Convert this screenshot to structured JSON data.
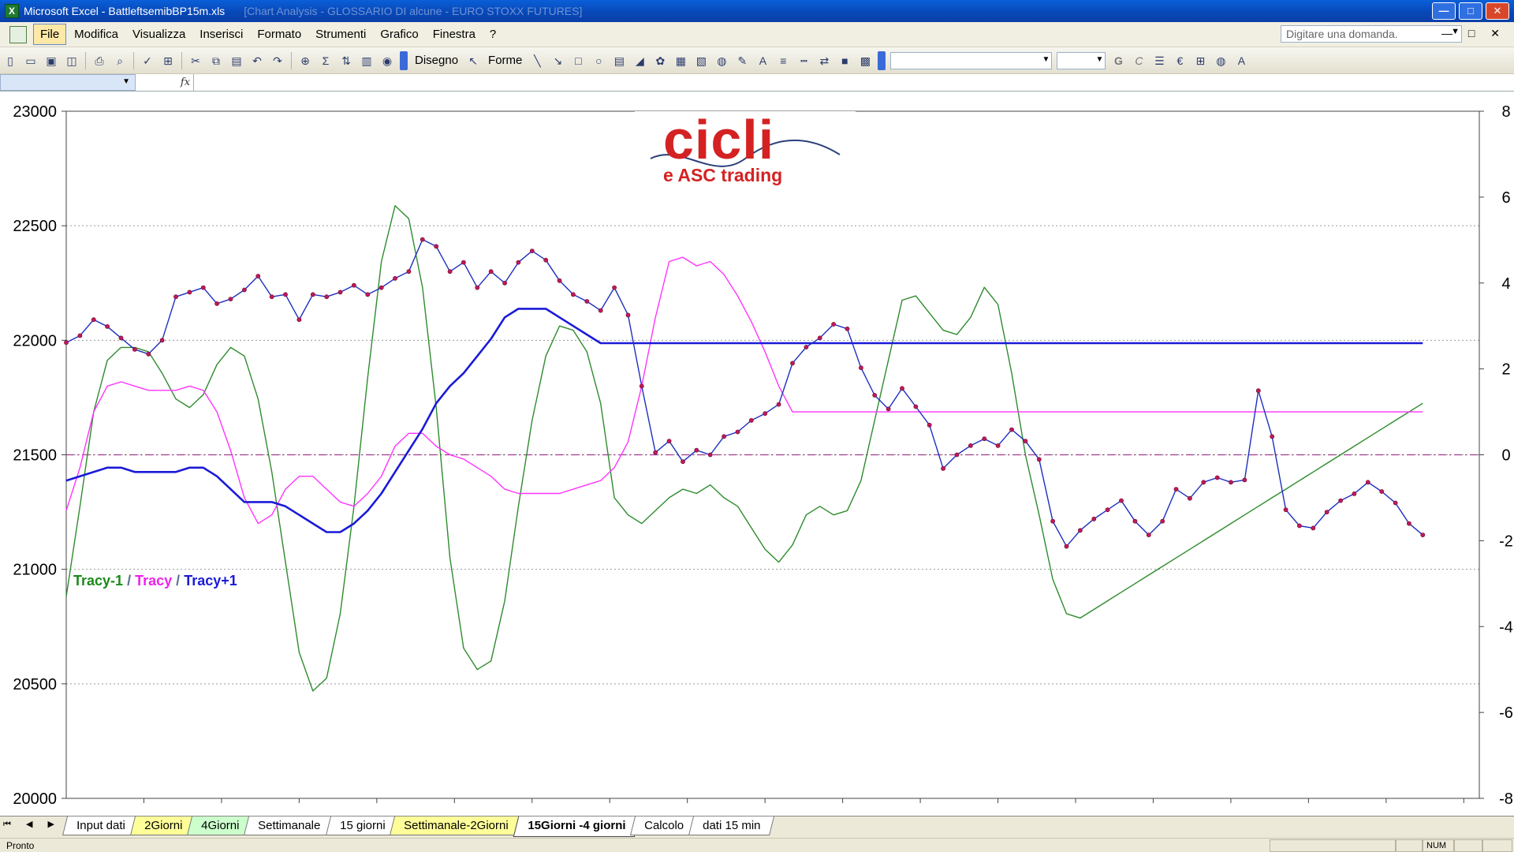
{
  "window": {
    "app_title": "Microsoft Excel - BattleftsemibBP15m.xls",
    "faded_title": "[Chart Analysis - GLOSSARIO DI alcune - EURO STOXX FUTURES]",
    "min_glyph": "—",
    "max_glyph": "□",
    "close_glyph": "✕"
  },
  "menu": {
    "items": [
      "File",
      "Modifica",
      "Visualizza",
      "Inserisci",
      "Formato",
      "Strumenti",
      "Grafico",
      "Finestra",
      "?"
    ],
    "help_placeholder": "Digitare una domanda.",
    "controls": "— □ ✕"
  },
  "toolbar": {
    "draw_label": "Disegno",
    "shapes_label": "Forme",
    "bold_glyph": "G",
    "italic_glyph": "C",
    "euro_glyph": "€",
    "sum_glyph": "Σ"
  },
  "formula": {
    "fx": "fx"
  },
  "logo": {
    "big": "cicli",
    "small": "e ASC trading"
  },
  "legend": {
    "s1": "Tracy-1",
    "s2": "Tracy",
    "s3": "Tracy+1",
    "sep": "/"
  },
  "sheets": {
    "nav": "⏮ ◀ ▶ ⏭",
    "tabs": [
      {
        "label": "Input dati",
        "style": "white"
      },
      {
        "label": "2Giorni",
        "style": "yellow"
      },
      {
        "label": "4Giorni",
        "style": "green"
      },
      {
        "label": "Settimanale",
        "style": "white"
      },
      {
        "label": "15 giorni",
        "style": "white"
      },
      {
        "label": "Settimanale-2Giorni",
        "style": "yellow"
      },
      {
        "label": "15Giorni -4 giorni",
        "style": "active"
      },
      {
        "label": "Calcolo",
        "style": "white"
      },
      {
        "label": "dati 15 min",
        "style": "white"
      }
    ]
  },
  "status": {
    "text": "Pronto",
    "num": "NUM"
  },
  "colors": {
    "price": "#1d2fbf",
    "price_marker": "#c2185b",
    "tracy_minus1": "#2e8b2e",
    "tracy": "#ff33ff",
    "tracy_plus1": "#1a1ad8",
    "zero_line": "#a23a8e"
  },
  "chart_data": {
    "type": "line",
    "left_axis": {
      "min": 20000,
      "max": 23000,
      "ticks": [
        "20000",
        "20500",
        "21000",
        "21500",
        "22000",
        "22500",
        "23000"
      ]
    },
    "right_axis": {
      "min": -8,
      "max": 8,
      "ticks": [
        "-8",
        "-6",
        "-4",
        "-2",
        "0",
        "2",
        "4",
        "6",
        "8"
      ]
    },
    "grid": "dotted horizontal",
    "n_points": 100,
    "series": [
      {
        "name": "Price",
        "axis": "left",
        "markers": true,
        "values": [
          21990,
          22020,
          22090,
          22060,
          22010,
          21960,
          21940,
          22000,
          22190,
          22210,
          22230,
          22160,
          22180,
          22220,
          22280,
          22190,
          22200,
          22090,
          22200,
          22190,
          22210,
          22240,
          22200,
          22230,
          22270,
          22300,
          22440,
          22410,
          22300,
          22340,
          22230,
          22300,
          22250,
          22340,
          22390,
          22350,
          22260,
          22200,
          22170,
          22130,
          22230,
          22110,
          21800,
          21510,
          21560,
          21470,
          21520,
          21500,
          21580,
          21600,
          21650,
          21680,
          21720,
          21900,
          21970,
          22010,
          22070,
          22050,
          21880,
          21760,
          21700,
          21790,
          21710,
          21630,
          21440,
          21500,
          21540,
          21570,
          21540,
          21610,
          21560,
          21480,
          21210,
          21100,
          21170,
          21220,
          21260,
          21300,
          21210,
          21150,
          21210,
          21350,
          21310,
          21380,
          21400,
          21380,
          21390,
          21780,
          21580,
          21260,
          21190,
          21180,
          21250,
          21300,
          21330,
          21380,
          21340,
          21290,
          21200,
          21150
        ]
      },
      {
        "name": "Tracy-1",
        "axis": "right",
        "values": [
          -3.3,
          -1.2,
          1.0,
          2.2,
          2.5,
          2.5,
          2.4,
          1.9,
          1.3,
          1.1,
          1.4,
          2.1,
          2.5,
          2.3,
          1.3,
          -0.4,
          -2.5,
          -4.6,
          -5.5,
          -5.2,
          -3.7,
          -1.2,
          1.8,
          4.5,
          5.8,
          5.5,
          3.9,
          1.1,
          -2.4,
          -4.5,
          -5.0,
          -4.8,
          -3.4,
          -1.2,
          0.8,
          2.3,
          3.0,
          2.9,
          2.4,
          1.2,
          -1.0,
          -1.4,
          -1.6,
          -1.3,
          -1.0,
          -0.8,
          -0.9,
          -0.7,
          -1.0,
          -1.2,
          -1.7,
          -2.2,
          -2.5,
          -2.1,
          -1.4,
          -1.2,
          -1.4,
          -1.3,
          -0.6,
          0.8,
          2.2,
          3.6,
          3.7,
          3.3,
          2.9,
          2.8,
          3.2,
          3.9,
          3.5,
          1.9,
          0.0,
          -1.4,
          -2.9,
          -3.7,
          -3.8,
          -3.6,
          -3.4,
          -3.2,
          -3.0,
          -2.8,
          -2.6,
          -2.4,
          -2.2,
          -2.0,
          -1.8,
          -1.6,
          -1.4,
          -1.2,
          -1.0,
          -0.8,
          -0.6,
          -0.4,
          -0.2,
          0.0,
          0.2,
          0.4,
          0.6,
          0.8,
          1.0,
          1.2
        ]
      },
      {
        "name": "Tracy",
        "axis": "right",
        "values": [
          -1.3,
          -0.3,
          1.0,
          1.6,
          1.7,
          1.6,
          1.5,
          1.5,
          1.5,
          1.6,
          1.5,
          1.0,
          0.1,
          -1.0,
          -1.6,
          -1.4,
          -0.8,
          -0.5,
          -0.5,
          -0.8,
          -1.1,
          -1.2,
          -0.9,
          -0.5,
          0.2,
          0.5,
          0.5,
          0.2,
          0.0,
          -0.1,
          -0.3,
          -0.5,
          -0.8,
          -0.9,
          -0.9,
          -0.9,
          -0.9,
          -0.8,
          -0.7,
          -0.6,
          -0.3,
          0.3,
          1.6,
          3.2,
          4.5,
          4.6,
          4.4,
          4.5,
          4.2,
          3.7,
          3.1,
          2.4,
          1.6,
          1.0,
          1.0,
          1.0,
          1.0,
          1.0,
          1.0,
          1.0,
          1.0,
          1.0,
          1.0,
          1.0,
          1.0,
          1.0,
          1.0,
          1.0,
          1.0,
          1.0,
          1.0,
          1.0,
          1.0,
          1.0,
          1.0,
          1.0,
          1.0,
          1.0,
          1.0,
          1.0,
          1.0,
          1.0,
          1.0,
          1.0,
          1.0,
          1.0,
          1.0,
          1.0,
          1.0,
          1.0,
          1.0,
          1.0,
          1.0,
          1.0,
          1.0,
          1.0,
          1.0,
          1.0,
          1.0,
          1.0
        ]
      },
      {
        "name": "Tracy+1",
        "axis": "right",
        "values": [
          -0.6,
          -0.5,
          -0.4,
          -0.3,
          -0.3,
          -0.4,
          -0.4,
          -0.4,
          -0.4,
          -0.3,
          -0.3,
          -0.5,
          -0.8,
          -1.1,
          -1.1,
          -1.1,
          -1.2,
          -1.4,
          -1.6,
          -1.8,
          -1.8,
          -1.6,
          -1.3,
          -0.9,
          -0.4,
          0.1,
          0.6,
          1.2,
          1.6,
          1.9,
          2.3,
          2.7,
          3.2,
          3.4,
          3.4,
          3.4,
          3.2,
          3.0,
          2.8,
          2.6,
          2.6,
          2.6,
          2.6,
          2.6,
          2.6,
          2.6,
          2.6,
          2.6,
          2.6,
          2.6,
          2.6,
          2.6,
          2.6,
          2.6,
          2.6,
          2.6,
          2.6,
          2.6,
          2.6,
          2.6,
          2.6,
          2.6,
          2.6,
          2.6,
          2.6,
          2.6,
          2.6,
          2.6,
          2.6,
          2.6,
          2.6,
          2.6,
          2.6,
          2.6,
          2.6,
          2.6,
          2.6,
          2.6,
          2.6,
          2.6,
          2.6,
          2.6,
          2.6,
          2.6,
          2.6,
          2.6,
          2.6,
          2.6,
          2.6,
          2.6,
          2.6,
          2.6,
          2.6,
          2.6,
          2.6,
          2.6,
          2.6,
          2.6,
          2.6,
          2.6
        ]
      }
    ],
    "zero_line": 0
  }
}
